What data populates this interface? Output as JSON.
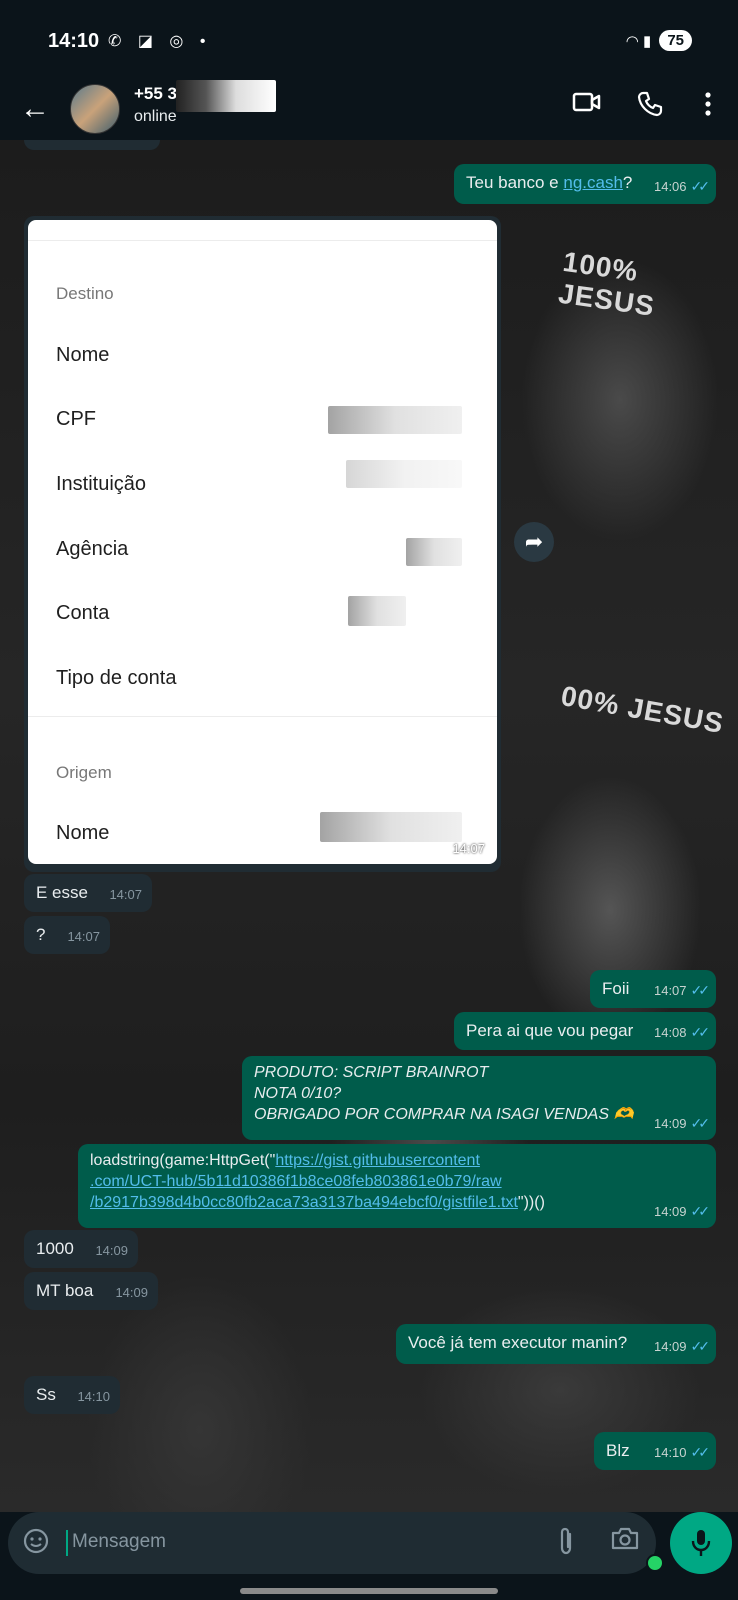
{
  "status": {
    "time": "14:10",
    "battery": "75"
  },
  "header": {
    "contact_name": "+55 3",
    "contact_status": "online"
  },
  "card": {
    "section_destino": "Destino",
    "row_nome": "Nome",
    "row_cpf": "CPF",
    "row_instituicao": "Instituição",
    "row_agencia": "Agência",
    "row_conta": "Conta",
    "row_tipo": "Tipo de conta",
    "section_origem": "Origem",
    "row_nome_origem": "Nome",
    "time": "14:07"
  },
  "messages": [
    {
      "dir": "out",
      "text_before": "Teu banco e ",
      "link": "ng.cash",
      "text_after": "?",
      "time": "14:06"
    },
    {
      "dir": "in",
      "text": "E esse",
      "time": "14:07"
    },
    {
      "dir": "in",
      "text": "?",
      "time": "14:07"
    },
    {
      "dir": "out",
      "text": "Foii",
      "time": "14:07"
    },
    {
      "dir": "out",
      "text": "Pera ai que vou pegar",
      "time": "14:08"
    },
    {
      "dir": "out",
      "lines": [
        "PRODUTO: SCRIPT BRAINROT",
        "NOTA 0/10?",
        "OBRIGADO POR COMPRAR NA ISAGI VENDAS 🫶"
      ],
      "time": "14:09"
    },
    {
      "dir": "out",
      "prefix": "loadstring(game:HttpGet(\"",
      "link1": "https://gist.githubusercontent",
      "link2": ".com/UCT-hub/5b11d10386f1b8ce08feb803861e0b79/raw",
      "link3": "/b2917b398d4b0cc80fb2aca73a3137ba494ebcf0/gistfile1.txt",
      "suffix": "\"))()",
      "time": "14:09"
    },
    {
      "dir": "in",
      "text": "1000",
      "time": "14:09"
    },
    {
      "dir": "in",
      "text": "MT boa",
      "time": "14:09"
    },
    {
      "dir": "out",
      "text": "Você já tem executor manin?",
      "time": "14:09"
    },
    {
      "dir": "in",
      "text": "Ss",
      "time": "14:10"
    },
    {
      "dir": "out",
      "text": "Blz",
      "time": "14:10"
    }
  ],
  "input": {
    "placeholder": "Mensagem"
  },
  "colors": {
    "outgoing_bubble": "#005c4b",
    "incoming_bubble": "#202c33",
    "accent": "#00a884",
    "link": "#53bdeb"
  },
  "icons": [
    "back-arrow-icon",
    "video-call-icon",
    "phone-icon",
    "more-options-icon",
    "forward-icon",
    "sticker-icon",
    "attach-icon",
    "camera-icon",
    "mic-icon"
  ]
}
